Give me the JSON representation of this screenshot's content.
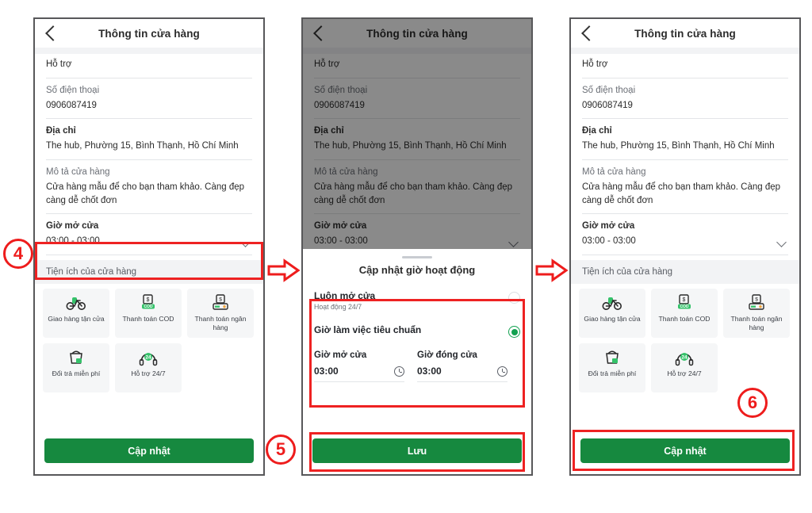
{
  "meta": {
    "accent_green": "#16893f",
    "annotation_red": "#ee1c1c",
    "radio_green": "#12a150"
  },
  "app": {
    "title": "Thông tin cửa hàng",
    "back_icon": "chevron-left-icon"
  },
  "form": {
    "partial_top_value": "Hỗ trợ",
    "fields": [
      {
        "label": "Số điện thoại",
        "value": "0906087419",
        "bold_label": false
      },
      {
        "label": "Địa chỉ",
        "value": "The hub, Phường 15, Bình Thạnh, Hồ Chí Minh",
        "bold_label": true
      },
      {
        "label": "Mô tả cửa hàng",
        "value": "Cửa hàng mẫu để cho bạn tham khảo. Càng đẹp càng dễ chốt đơn",
        "bold_label": false
      }
    ],
    "hours": {
      "label": "Giờ mở cửa",
      "value": "03:00 - 03:00",
      "chevron_icon": "chevron-down-icon"
    },
    "utilities": {
      "section_title": "Tiện ích của cửa hàng",
      "tiles": [
        {
          "label": "Giao hàng tận cửa",
          "icon": "delivery-bike-icon"
        },
        {
          "label": "Thanh toán COD",
          "icon": "cod-cash-icon"
        },
        {
          "label": "Thanh toán ngân hàng",
          "icon": "bank-payment-icon"
        },
        {
          "label": "Đổi trả miễn phí",
          "icon": "return-box-icon"
        },
        {
          "label": "Hỗ trợ 24/7",
          "icon": "headset-24-icon"
        }
      ]
    },
    "submit_label": "Cập nhật"
  },
  "sheet": {
    "title": "Cập nhật giờ hoạt động",
    "options": [
      {
        "name": "Luôn mở cửa",
        "sub": "Hoạt động 24/7",
        "selected": false
      },
      {
        "name": "Giờ làm việc tiêu chuẩn",
        "sub": "",
        "selected": true
      }
    ],
    "open_time": {
      "label": "Giờ mở cửa",
      "value": "03:00",
      "icon": "clock-icon"
    },
    "close_time": {
      "label": "Giờ đóng cửa",
      "value": "03:00",
      "icon": "clock-icon"
    },
    "save_label": "Lưu"
  },
  "annotations": {
    "steps": [
      {
        "number": "④",
        "plain": "4"
      },
      {
        "number": "⑤",
        "plain": "5"
      },
      {
        "number": "⑥",
        "plain": "6"
      }
    ],
    "arrow_icon": "right-arrow-icon"
  }
}
